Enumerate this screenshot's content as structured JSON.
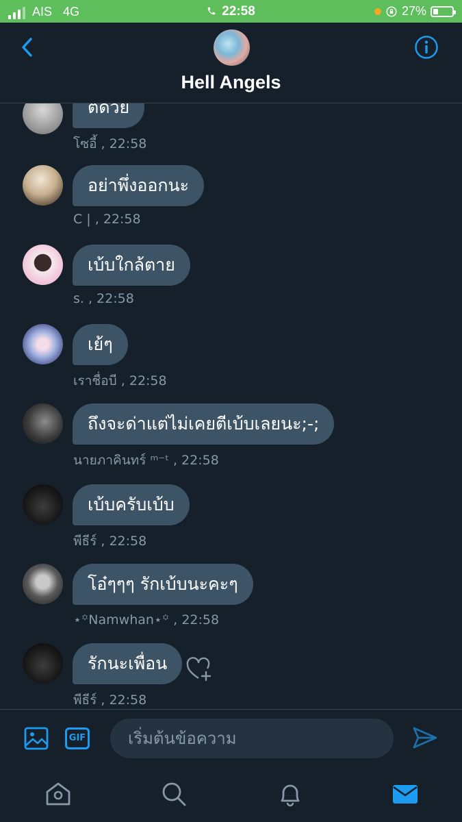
{
  "status_bar": {
    "carrier": "AIS",
    "network": "4G",
    "time": "22:58",
    "battery_percent": "27%",
    "battery_level": 0.27,
    "background_color": "#5dbe5b"
  },
  "header": {
    "title": "Hell Angels",
    "back_icon": "chevron-left-icon",
    "info_icon": "info-icon",
    "accent_color": "#1d9bf0"
  },
  "messages": [
    {
      "text": "ตดวย",
      "sender": "โซอี้",
      "time": "22:58",
      "meta": "โซอี้  , 22:58"
    },
    {
      "text": "อย่าพึ่งออกนะ",
      "sender": "C |",
      "time": "22:58",
      "meta": "C |  , 22:58"
    },
    {
      "text": "เบ้บใกล้ตาย",
      "sender": "s.",
      "time": "22:58",
      "meta": "s.  , 22:58"
    },
    {
      "text": "เย้ๆ",
      "sender": "เราชื่อบี",
      "time": "22:58",
      "meta": "เราชื่อบี  , 22:58"
    },
    {
      "text": "ถึงจะด่าแต่ไม่เคยตีเบ้บเลยนะ;-;",
      "sender": "นายภาคินทร์ ᵐ⁻ᵗ",
      "time": "22:58",
      "meta": "นายภาคินทร์ ᵐ⁻ᵗ  , 22:58"
    },
    {
      "text": "เบ้บครับเบ้บ",
      "sender": "พีธีร์",
      "time": "22:58",
      "meta": "พีธีร์ , 22:58"
    },
    {
      "text": "โอ๋ๆๆๆ รักเบ้บนะคะๆ",
      "sender": "⋆꙳Namwhan⋆꙳",
      "time": "22:58",
      "meta": "⋆꙳Namwhan⋆꙳ , 22:58"
    },
    {
      "text": "รักนะเพื่อน",
      "sender": "พีธีร์",
      "time": "22:58",
      "meta": "พีธีร์ , 22:58"
    }
  ],
  "composer": {
    "placeholder": "เริ่มต้นข้อความ",
    "gif_label": "GIF",
    "media_icon": "image-icon",
    "send_icon": "send-icon"
  },
  "bottom_nav": [
    {
      "name": "home-icon"
    },
    {
      "name": "search-icon"
    },
    {
      "name": "bell-icon"
    },
    {
      "name": "mail-icon",
      "active": true
    }
  ],
  "colors": {
    "background": "#15202b",
    "bubble": "#3d5466",
    "meta_text": "#8899a6",
    "accent": "#1d9bf0"
  }
}
